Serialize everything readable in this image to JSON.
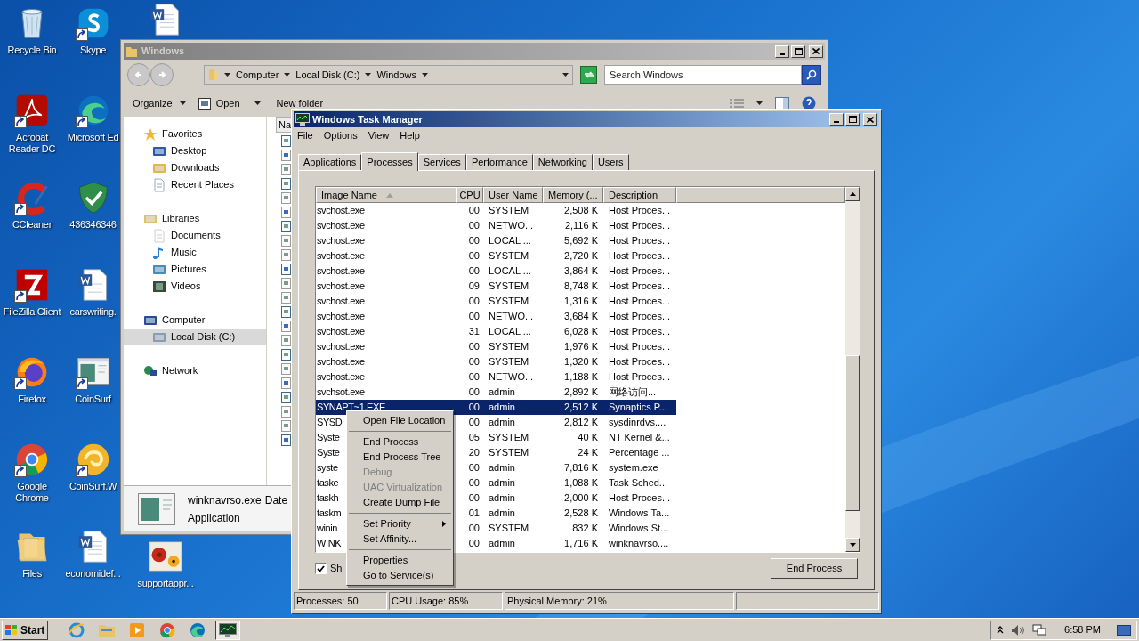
{
  "desktop": {
    "columns": [
      [
        {
          "label": "Recycle Bin",
          "kind": "recycle",
          "shortcut": false
        },
        {
          "label": "Acrobat Reader DC",
          "kind": "acrobat",
          "shortcut": true
        },
        {
          "label": "CCleaner",
          "kind": "ccleaner",
          "shortcut": true
        },
        {
          "label": "FileZilla Client",
          "kind": "filezilla",
          "shortcut": true
        },
        {
          "label": "Firefox",
          "kind": "firefox",
          "shortcut": true
        },
        {
          "label": "Google Chrome",
          "kind": "chrome",
          "shortcut": true
        },
        {
          "label": "Files",
          "kind": "folder",
          "shortcut": false
        }
      ],
      [
        {
          "label": "Skype",
          "kind": "skype",
          "shortcut": true
        },
        {
          "label": "Microsoft Ed",
          "kind": "edge",
          "shortcut": true
        },
        {
          "label": "436346346",
          "kind": "shield",
          "shortcut": false
        },
        {
          "label": "carswriting.",
          "kind": "word",
          "shortcut": false
        },
        {
          "label": "CoinSurf",
          "kind": "app",
          "shortcut": true
        },
        {
          "label": "CoinSurf.W",
          "kind": "coinsurf",
          "shortcut": true
        },
        {
          "label": "economidef...",
          "kind": "word",
          "shortcut": false
        }
      ],
      [
        {
          "kind": "word",
          "shortcut": false
        },
        {
          "label": "supportappr...",
          "kind": "photo",
          "shortcut": false
        }
      ]
    ]
  },
  "explorer": {
    "title": "Windows",
    "breadcrumb": [
      "Computer",
      "Local Disk (C:)",
      "Windows"
    ],
    "search": {
      "placeholder": "Search Windows"
    },
    "toolbar": [
      {
        "label": "Organize",
        "kind": "menu"
      },
      {
        "label": "Open",
        "kind": "open"
      },
      {
        "label": "New folder",
        "kind": "plain"
      }
    ],
    "nav": [
      {
        "label": "Favorites",
        "kind": "star",
        "selected": false,
        "children": [
          {
            "label": "Desktop",
            "kind": "desktop",
            "selected": false
          },
          {
            "label": "Downloads",
            "kind": "downloads",
            "selected": false
          },
          {
            "label": "Recent Places",
            "kind": "recent",
            "selected": false
          }
        ]
      },
      {
        "label": "Libraries",
        "kind": "library",
        "selected": false,
        "children": [
          {
            "label": "Documents",
            "kind": "documents",
            "selected": false
          },
          {
            "label": "Music",
            "kind": "music",
            "selected": false
          },
          {
            "label": "Pictures",
            "kind": "pictures",
            "selected": false
          },
          {
            "label": "Videos",
            "kind": "videos",
            "selected": false
          }
        ]
      },
      {
        "label": "Computer",
        "kind": "computer",
        "selected": false,
        "children": [
          {
            "label": "Local Disk (C:)",
            "kind": "disk",
            "selected": true
          }
        ]
      },
      {
        "label": "Network",
        "kind": "network",
        "selected": false
      }
    ],
    "column_header": "Na",
    "details": {
      "name": "winknavrso.exe",
      "column_2": "Date",
      "type": "Application"
    }
  },
  "task_manager": {
    "title": "Windows Task Manager",
    "menu": [
      "File",
      "Options",
      "View",
      "Help"
    ],
    "tabs": [
      {
        "label": "Applications",
        "selected": false
      },
      {
        "label": "Processes",
        "selected": true
      },
      {
        "label": "Services",
        "selected": false
      },
      {
        "label": "Performance",
        "selected": false
      },
      {
        "label": "Networking",
        "selected": false
      },
      {
        "label": "Users",
        "selected": false
      }
    ],
    "columns": [
      {
        "label": "Image Name",
        "sorted": true
      },
      {
        "label": "CPU",
        "sorted": false
      },
      {
        "label": "User Name",
        "sorted": false
      },
      {
        "label": "Memory (...",
        "sorted": false
      },
      {
        "label": "Description",
        "sorted": false
      }
    ],
    "rows": [
      {
        "cells": [
          "svchost.exe",
          "00",
          "SYSTEM",
          "2,508 K",
          "Host Proces..."
        ],
        "selected": false
      },
      {
        "cells": [
          "svchost.exe",
          "00",
          "NETWO...",
          "2,116 K",
          "Host Proces..."
        ],
        "selected": false
      },
      {
        "cells": [
          "svchost.exe",
          "00",
          "LOCAL ...",
          "5,692 K",
          "Host Proces..."
        ],
        "selected": false
      },
      {
        "cells": [
          "svchost.exe",
          "00",
          "SYSTEM",
          "2,720 K",
          "Host Proces..."
        ],
        "selected": false
      },
      {
        "cells": [
          "svchost.exe",
          "00",
          "LOCAL ...",
          "3,864 K",
          "Host Proces..."
        ],
        "selected": false
      },
      {
        "cells": [
          "svchost.exe",
          "09",
          "SYSTEM",
          "8,748 K",
          "Host Proces..."
        ],
        "selected": false
      },
      {
        "cells": [
          "svchost.exe",
          "00",
          "SYSTEM",
          "1,316 K",
          "Host Proces..."
        ],
        "selected": false
      },
      {
        "cells": [
          "svchost.exe",
          "00",
          "NETWO...",
          "3,684 K",
          "Host Proces..."
        ],
        "selected": false
      },
      {
        "cells": [
          "svchost.exe",
          "31",
          "LOCAL ...",
          "6,028 K",
          "Host Proces..."
        ],
        "selected": false
      },
      {
        "cells": [
          "svchost.exe",
          "00",
          "SYSTEM",
          "1,976 K",
          "Host Proces..."
        ],
        "selected": false
      },
      {
        "cells": [
          "svchost.exe",
          "00",
          "SYSTEM",
          "1,320 K",
          "Host Proces..."
        ],
        "selected": false
      },
      {
        "cells": [
          "svchost.exe",
          "00",
          "NETWO...",
          "1,188 K",
          "Host Proces..."
        ],
        "selected": false
      },
      {
        "cells": [
          "svchsot.exe",
          "00",
          "admin",
          "2,892 K",
          "网络访问..."
        ],
        "selected": false
      },
      {
        "cells": [
          "SYNAPT~1.EXE",
          "00",
          "admin",
          "2,512 K",
          "Synaptics P..."
        ],
        "selected": true
      },
      {
        "cells": [
          "SYSD",
          "00",
          "admin",
          "2,812 K",
          "sysdinrdvs...."
        ],
        "selected": false
      },
      {
        "cells": [
          "Syste",
          "05",
          "SYSTEM",
          "40 K",
          "NT Kernel &..."
        ],
        "selected": false
      },
      {
        "cells": [
          "Syste",
          "20",
          "SYSTEM",
          "24 K",
          "Percentage ..."
        ],
        "selected": false
      },
      {
        "cells": [
          "syste",
          "00",
          "admin",
          "7,816 K",
          "system.exe"
        ],
        "selected": false
      },
      {
        "cells": [
          "taske",
          "00",
          "admin",
          "1,088 K",
          "Task Sched..."
        ],
        "selected": false
      },
      {
        "cells": [
          "taskh",
          "00",
          "admin",
          "2,000 K",
          "Host Proces..."
        ],
        "selected": false
      },
      {
        "cells": [
          "taskm",
          "01",
          "admin",
          "2,528 K",
          "Windows Ta..."
        ],
        "selected": false
      },
      {
        "cells": [
          "winin",
          "00",
          "SYSTEM",
          "832 K",
          "Windows St..."
        ],
        "selected": false
      },
      {
        "cells": [
          "WINK",
          "00",
          "admin",
          "1,716 K",
          "winknavrso...."
        ],
        "selected": false
      }
    ],
    "show_all": {
      "label": "Sh",
      "checked": true
    },
    "end_button": "End Process",
    "status": [
      "Processes: 50",
      "CPU Usage: 85%",
      "Physical Memory: 21%"
    ]
  },
  "context_menu": {
    "groups": [
      [
        {
          "label": "Open File Location",
          "disabled": false,
          "submenu": false
        }
      ],
      [
        {
          "label": "End Process",
          "disabled": false,
          "submenu": false
        },
        {
          "label": "End Process Tree",
          "disabled": false,
          "submenu": false
        },
        {
          "label": "Debug",
          "disabled": true,
          "submenu": false
        },
        {
          "label": "UAC Virtualization",
          "disabled": true,
          "submenu": false
        },
        {
          "label": "Create Dump File",
          "disabled": false,
          "submenu": false
        }
      ],
      [
        {
          "label": "Set Priority",
          "disabled": false,
          "submenu": true
        },
        {
          "label": "Set Affinity...",
          "disabled": false,
          "submenu": false
        }
      ],
      [
        {
          "label": "Properties",
          "disabled": false,
          "submenu": false
        },
        {
          "label": "Go to Service(s)",
          "disabled": false,
          "submenu": false
        }
      ]
    ]
  },
  "taskbar": {
    "start": "Start",
    "items": [
      {
        "kind": "ie",
        "active": false
      },
      {
        "kind": "explorer",
        "active": false
      },
      {
        "kind": "media",
        "active": false
      },
      {
        "kind": "chrome",
        "active": false
      },
      {
        "kind": "edge",
        "active": false
      },
      {
        "kind": "taskmgr",
        "active": true
      }
    ],
    "clock": "6:58 PM"
  }
}
